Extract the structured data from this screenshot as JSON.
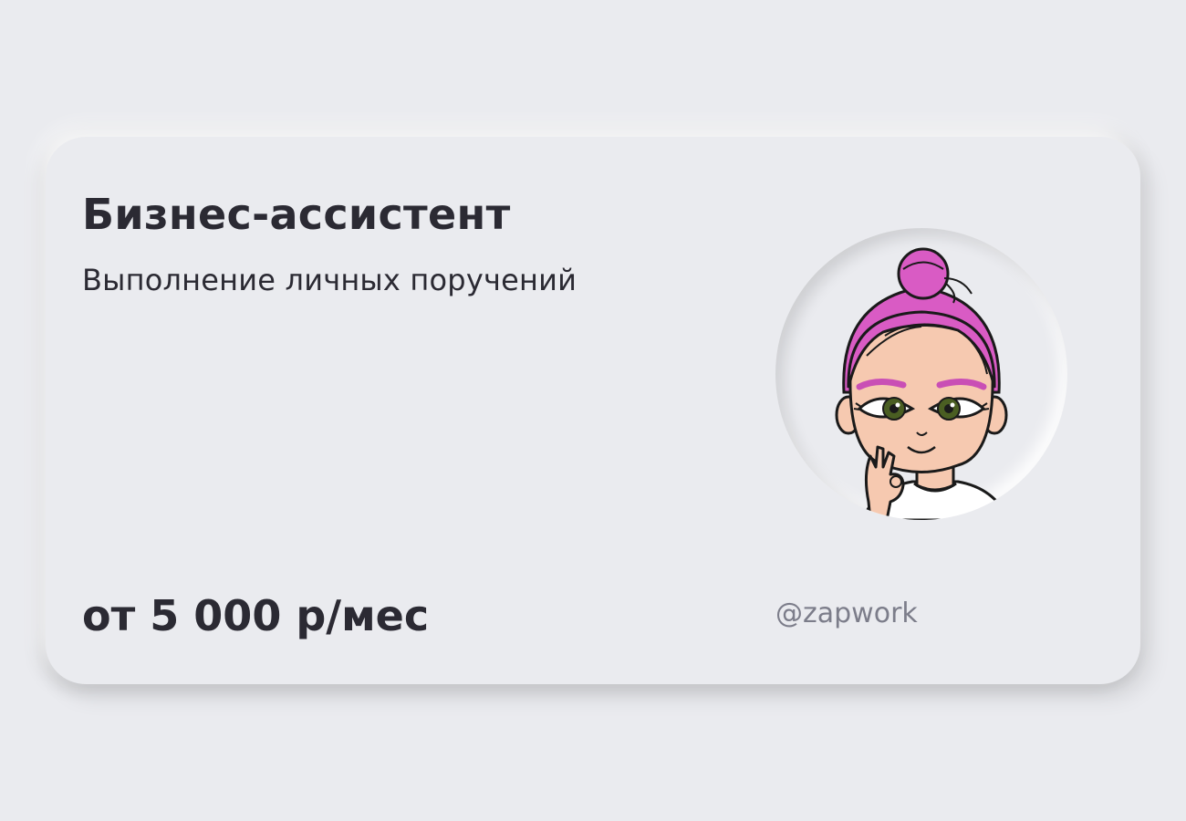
{
  "card": {
    "title": "Бизнес-ассистент",
    "subtitle": "Выполнение личных поручений",
    "price": "от 5 000 р/мес",
    "handle": "@zapwork"
  },
  "avatar": {
    "icon": "cartoon-girl-avatar",
    "hair_color": "#d95bc4",
    "skin_color": "#f6c9b0",
    "eye_color": "#4a5e22"
  },
  "colors": {
    "background": "#eaebef",
    "text": "#2b2a33",
    "muted_text": "#7c7d8a"
  }
}
